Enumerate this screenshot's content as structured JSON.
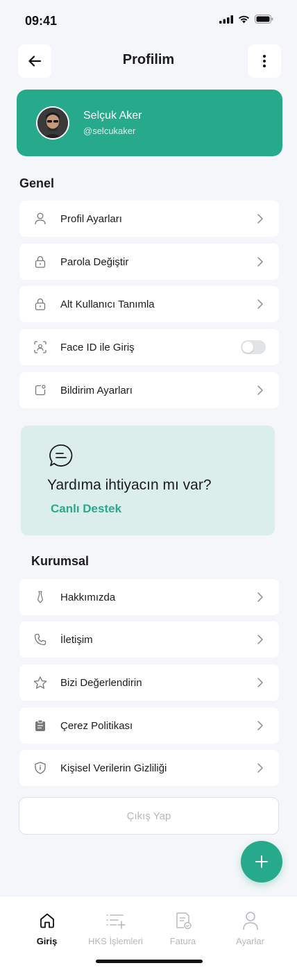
{
  "status": {
    "time": "09:41"
  },
  "header": {
    "title": "Profilim"
  },
  "profile": {
    "name": "Selçuk Aker",
    "username": "@selcukaker"
  },
  "general": {
    "title": "Genel",
    "items": [
      {
        "label": "Profil Ayarları",
        "icon": "user-icon"
      },
      {
        "label": "Parola Değiştir",
        "icon": "lock-icon"
      },
      {
        "label": "Alt Kullanıcı Tanımla",
        "icon": "lock-icon"
      },
      {
        "label": "Face ID ile Giriş",
        "icon": "face-id-icon",
        "toggle": false
      },
      {
        "label": "Bildirim Ayarları",
        "icon": "notification-icon"
      }
    ]
  },
  "help": {
    "title": "Yardıma ihtiyacın mı var?",
    "link": "Canlı Destek"
  },
  "corporate": {
    "title": "Kurumsal",
    "items": [
      {
        "label": "Hakkımızda",
        "icon": "tie-icon"
      },
      {
        "label": "İletişim",
        "icon": "phone-icon"
      },
      {
        "label": "Bizi Değerlendirin",
        "icon": "star-icon"
      },
      {
        "label": "Çerez Politikası",
        "icon": "clipboard-icon"
      },
      {
        "label": "Kişisel Verilerin Gizliliği",
        "icon": "shield-icon"
      }
    ]
  },
  "logout": {
    "label": "Çıkış Yap"
  },
  "nav": {
    "items": [
      {
        "label": "Giriş",
        "active": true
      },
      {
        "label": "HKS İşlemleri",
        "active": false
      },
      {
        "label": "Fatura",
        "active": false
      },
      {
        "label": "Ayarlar",
        "active": false
      }
    ]
  },
  "colors": {
    "accent": "#27a98c",
    "background": "#f4f6f9",
    "help_bg": "#dceeec",
    "muted": "#b5b8be"
  }
}
